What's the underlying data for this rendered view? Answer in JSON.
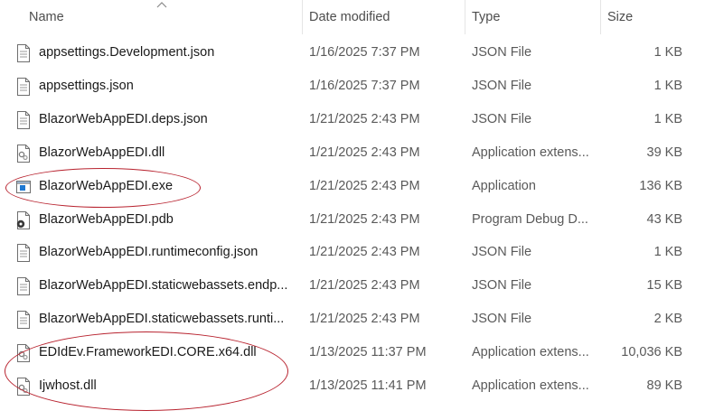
{
  "columns": {
    "name": "Name",
    "date": "Date modified",
    "type": "Type",
    "size": "Size"
  },
  "files": [
    {
      "name": "appsettings.Development.json",
      "date": "1/16/2025 7:37 PM",
      "type": "JSON File",
      "size": "1 KB",
      "icon": "document-icon"
    },
    {
      "name": "appsettings.json",
      "date": "1/16/2025 7:37 PM",
      "type": "JSON File",
      "size": "1 KB",
      "icon": "document-icon"
    },
    {
      "name": "BlazorWebAppEDI.deps.json",
      "date": "1/21/2025 2:43 PM",
      "type": "JSON File",
      "size": "1 KB",
      "icon": "document-icon"
    },
    {
      "name": "BlazorWebAppEDI.dll",
      "date": "1/21/2025 2:43 PM",
      "type": "Application extens...",
      "size": "39 KB",
      "icon": "dll-icon"
    },
    {
      "name": "BlazorWebAppEDI.exe",
      "date": "1/21/2025 2:43 PM",
      "type": "Application",
      "size": "136 KB",
      "icon": "exe-icon"
    },
    {
      "name": "BlazorWebAppEDI.pdb",
      "date": "1/21/2025 2:43 PM",
      "type": "Program Debug D...",
      "size": "43 KB",
      "icon": "pdb-icon"
    },
    {
      "name": "BlazorWebAppEDI.runtimeconfig.json",
      "date": "1/21/2025 2:43 PM",
      "type": "JSON File",
      "size": "1 KB",
      "icon": "document-icon"
    },
    {
      "name": "BlazorWebAppEDI.staticwebassets.endp...",
      "date": "1/21/2025 2:43 PM",
      "type": "JSON File",
      "size": "15 KB",
      "icon": "document-icon"
    },
    {
      "name": "BlazorWebAppEDI.staticwebassets.runti...",
      "date": "1/21/2025 2:43 PM",
      "type": "JSON File",
      "size": "2 KB",
      "icon": "document-icon"
    },
    {
      "name": "EDIdEv.FrameworkEDI.CORE.x64.dll",
      "date": "1/13/2025 11:37 PM",
      "type": "Application extens...",
      "size": "10,036 KB",
      "icon": "dll-icon"
    },
    {
      "name": "Ijwhost.dll",
      "date": "1/13/2025 11:41 PM",
      "type": "Application extens...",
      "size": "89 KB",
      "icon": "dll-icon"
    }
  ],
  "colors": {
    "annotation": "#b8232f",
    "header_text": "#4d4d4d",
    "secondary_text": "#595959"
  }
}
